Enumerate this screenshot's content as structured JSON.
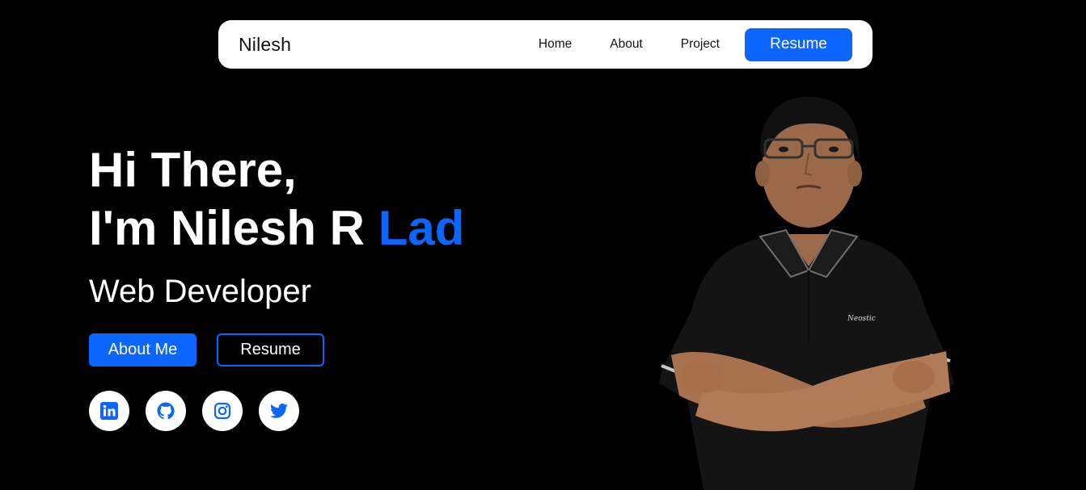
{
  "navbar": {
    "brand": "Nilesh",
    "links": [
      {
        "label": "Home"
      },
      {
        "label": "About"
      },
      {
        "label": "Project"
      }
    ],
    "resume_label": "Resume"
  },
  "hero": {
    "greeting": "Hi There,",
    "name_prefix": "I'm Nilesh R ",
    "name_accent": "Lad",
    "role": "Web Developer",
    "about_button": "About Me",
    "resume_button": "Resume"
  },
  "socials": [
    {
      "icon": "linkedin-icon"
    },
    {
      "icon": "github-icon"
    },
    {
      "icon": "instagram-icon"
    },
    {
      "icon": "twitter-icon"
    }
  ],
  "colors": {
    "accent": "#0a66ff",
    "background": "#000000",
    "navbar": "#ffffff"
  },
  "portrait": {
    "description_icon": "profile-photo"
  }
}
